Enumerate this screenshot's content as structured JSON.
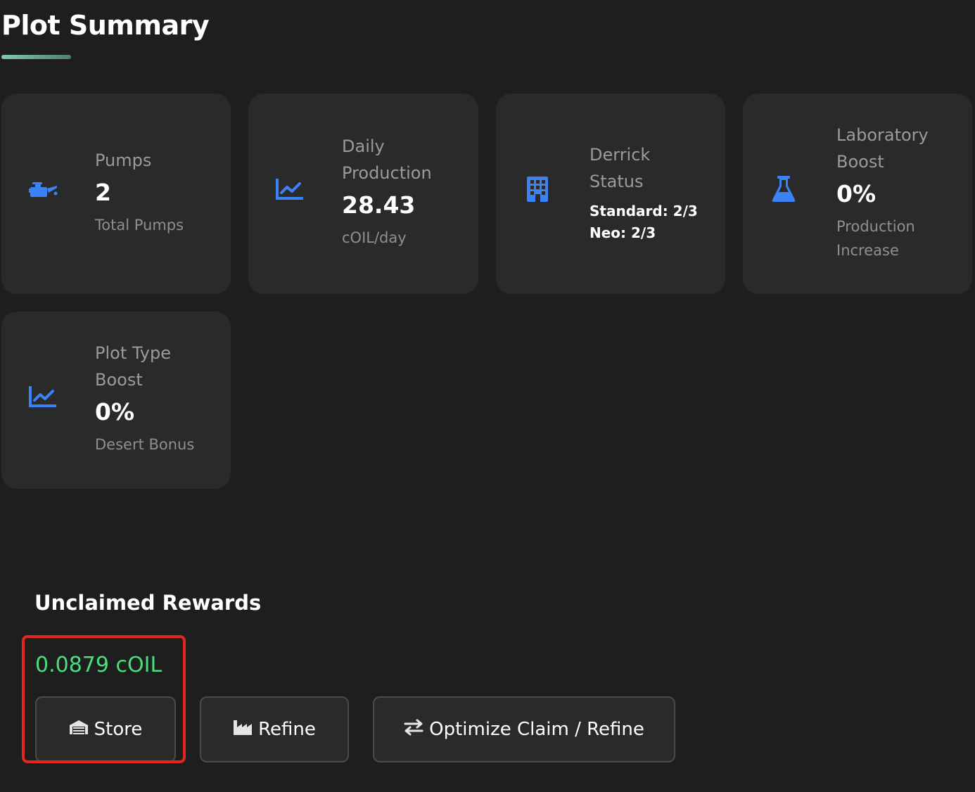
{
  "header": {
    "title": "Plot Summary"
  },
  "cards": [
    {
      "icon": "oil-can-icon",
      "label": "Pumps",
      "value": "2",
      "sub": "Total Pumps"
    },
    {
      "icon": "chart-line-icon",
      "label": "Daily\nProduction",
      "value": "28.43",
      "sub": "cOIL/day"
    },
    {
      "icon": "building-icon",
      "label": "Derrick\nStatus",
      "status_standard": "Standard: 2/3",
      "status_neo": "Neo: 2/3"
    },
    {
      "icon": "flask-icon",
      "label": "Laboratory\nBoost",
      "value": "0%",
      "sub": "Production\nIncrease"
    },
    {
      "icon": "chart-line-icon",
      "label": "Plot Type\nBoost",
      "value": "0%",
      "sub": "Desert Bonus"
    }
  ],
  "rewards": {
    "title": "Unclaimed Rewards",
    "amount": "0.0879 cOIL",
    "buttons": {
      "store": "Store",
      "refine": "Refine",
      "optimize": "Optimize Claim / Refine"
    }
  },
  "colors": {
    "background": "#1e1e1e",
    "card": "#2a2a2a",
    "icon_accent": "#3b82f6",
    "reward_green": "#4ade80",
    "highlight_red": "#e3261e"
  }
}
